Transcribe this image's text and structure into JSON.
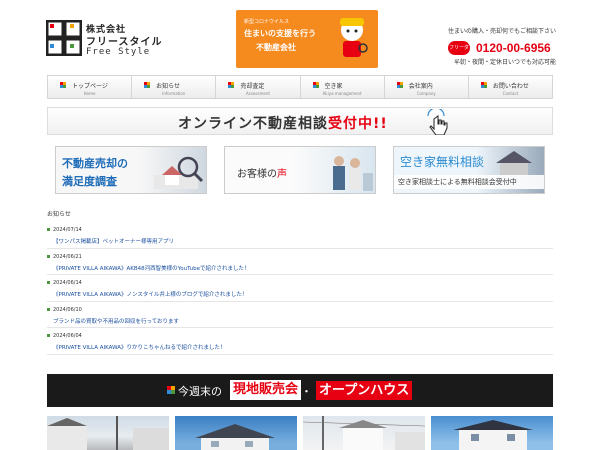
{
  "header": {
    "company_line1": "株式会社",
    "company_line2": "フリースタイル",
    "brand_en": "Free Style",
    "top_banner": {
      "line1": "新型コロナウイルス",
      "line2": "住まいの支援を行う",
      "line3": "不動産会社"
    },
    "contact": {
      "top": "住まいの購入・売却何でもご相談下さい",
      "free_label": "フリーダイヤル",
      "phone": "0120-00-6956",
      "bottom": "早朝・夜間・定休日いつでも対応可能"
    }
  },
  "nav": [
    {
      "jp": "トップページ",
      "en": "Home"
    },
    {
      "jp": "お知らせ",
      "en": "Information"
    },
    {
      "jp": "売却査定",
      "en": "Assessment"
    },
    {
      "jp": "空き家",
      "en": "Akiya management"
    },
    {
      "jp": "会社案内",
      "en": "Company"
    },
    {
      "jp": "お問い合わせ",
      "en": "Contact"
    }
  ],
  "online_banner": {
    "text_main": "オンライン不動産相談",
    "text_red": "受付中!!"
  },
  "banners": {
    "b1_line1": "不動産売却の",
    "b1_line2": "満足度調査",
    "b2_pre": "お客様の",
    "b2_red": "声",
    "b3_line1": "空き家無料相談",
    "b3_line2": "空き家相談士による無料相談会受付中"
  },
  "news": {
    "heading": "お知らせ",
    "items": [
      {
        "date": "2024/07/14",
        "title": "【ワンパス掲載店】ペットオーナー様専用アプリ"
      },
      {
        "date": "2024/06/21",
        "title": "《PRIVATE VILLA AIKAWA》AKB48河西智美様のYouTubeで紹介されました！"
      },
      {
        "date": "2024/06/14",
        "title": "《PRIVATE VILLA AIKAWA》ノンスタイル井上様のブログで紹介されました！"
      },
      {
        "date": "2024/06/10",
        "title": "ブランド品の買取や不用品の回収を行っております"
      },
      {
        "date": "2024/06/04",
        "title": "《PRIVATE VILLA AIKAWA》りかりこちゃんねるで紹介されました！"
      }
    ]
  },
  "open_house": {
    "part1": "今週末の",
    "part2": "現地販売会",
    "dot": "・",
    "part3": "オープンハウス"
  },
  "colors": {
    "accent_red": "#e60012",
    "link_blue": "#1a4fa0",
    "orange": "#f58a1f",
    "green": "#4a9a3d"
  }
}
